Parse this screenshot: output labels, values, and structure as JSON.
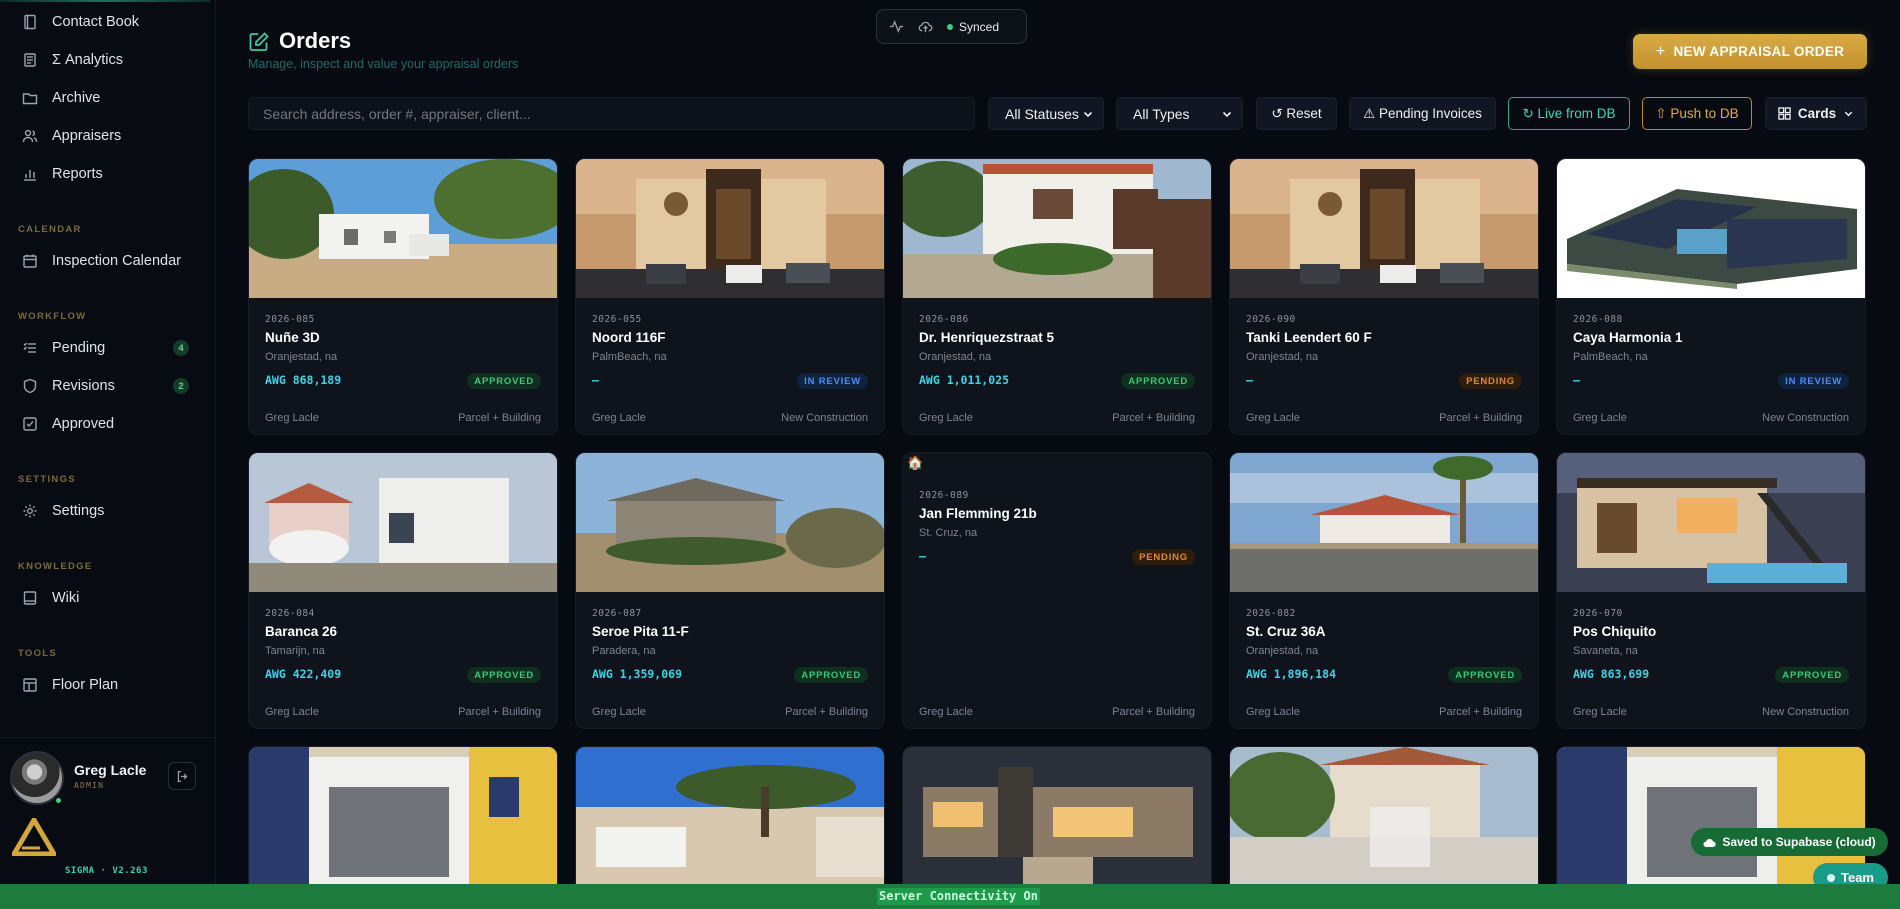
{
  "sidebar": {
    "items": [
      {
        "label": "Contact Book",
        "icon": "book-icon"
      },
      {
        "label": "Σ Analytics",
        "icon": "analytics-icon"
      },
      {
        "label": "Archive",
        "icon": "archive-icon"
      },
      {
        "label": "Appraisers",
        "icon": "users-icon"
      },
      {
        "label": "Reports",
        "icon": "reports-icon"
      }
    ],
    "sections": {
      "calendar": "CALENDAR",
      "workflow": "WORKFLOW",
      "settings": "SETTINGS",
      "knowledge": "KNOWLEDGE",
      "tools": "TOOLS"
    },
    "calendar_items": [
      {
        "label": "Inspection Calendar",
        "icon": "calendar-icon"
      }
    ],
    "workflow_items": [
      {
        "label": "Pending",
        "icon": "list-icon",
        "count": "4"
      },
      {
        "label": "Revisions",
        "icon": "shield-icon",
        "count": "2"
      },
      {
        "label": "Approved",
        "icon": "check-square-icon"
      }
    ],
    "settings_items": [
      {
        "label": "Settings",
        "icon": "gear-icon"
      }
    ],
    "knowledge_items": [
      {
        "label": "Wiki",
        "icon": "wiki-icon"
      }
    ],
    "tools_items": [
      {
        "label": "Floor Plan",
        "icon": "floorplan-icon"
      }
    ],
    "user": {
      "name": "Greg Lacle",
      "role": "ADMIN"
    },
    "version": "SIGMA · V2.263"
  },
  "header": {
    "title": "Orders",
    "subtitle": "Manage, inspect and value your appraisal orders",
    "sync_label": "Synced",
    "new_order_label": "NEW APPRAISAL ORDER"
  },
  "filters": {
    "search_placeholder": "Search address, order #, appraiser, client...",
    "status_select": "All Statuses",
    "type_select": "All Types",
    "reset_label": "↺ Reset",
    "pending_invoices_label": "⚠ Pending Invoices",
    "live_label": "↻ Live from DB",
    "push_label": "⇧ Push to DB",
    "view_label": "Cards"
  },
  "orders": [
    {
      "order": "2026-085",
      "address": "Nuñe 3D",
      "location": "Oranjestad, na",
      "value": "AWG 868,189",
      "status": "APPROVED",
      "appraiser": "Greg Lacle",
      "type": "Parcel + Building"
    },
    {
      "order": "2026-055",
      "address": "Noord 116F",
      "location": "PalmBeach, na",
      "value": "—",
      "status": "IN REVIEW",
      "appraiser": "Greg Lacle",
      "type": "New Construction"
    },
    {
      "order": "2026-086",
      "address": "Dr. Henriquezstraat 5",
      "location": "Oranjestad, na",
      "value": "AWG 1,011,025",
      "status": "APPROVED",
      "appraiser": "Greg Lacle",
      "type": "Parcel + Building"
    },
    {
      "order": "2026-090",
      "address": "Tanki Leendert 60 F",
      "location": "Oranjestad, na",
      "value": "—",
      "status": "PENDING",
      "appraiser": "Greg Lacle",
      "type": "Parcel + Building"
    },
    {
      "order": "2026-088",
      "address": "Caya Harmonia 1",
      "location": "PalmBeach, na",
      "value": "—",
      "status": "IN REVIEW",
      "appraiser": "Greg Lacle",
      "type": "New Construction"
    },
    {
      "order": "2026-084",
      "address": "Baranca 26",
      "location": "Tamarijn, na",
      "value": "AWG 422,409",
      "status": "APPROVED",
      "appraiser": "Greg Lacle",
      "type": "Parcel + Building"
    },
    {
      "order": "2026-087",
      "address": "Seroe Pita 11-F",
      "location": "Paradera, na",
      "value": "AWG 1,359,069",
      "status": "APPROVED",
      "appraiser": "Greg Lacle",
      "type": "Parcel + Building"
    },
    {
      "order": "2026-089",
      "address": "Jan Flemming 21b",
      "location": "St. Cruz, na",
      "value": "—",
      "status": "PENDING",
      "appraiser": "Greg Lacle",
      "type": "Parcel + Building"
    },
    {
      "order": "2026-082",
      "address": "St. Cruz 36A",
      "location": "Oranjestad, na",
      "value": "AWG 1,896,184",
      "status": "APPROVED",
      "appraiser": "Greg Lacle",
      "type": "Parcel + Building"
    },
    {
      "order": "2026-070",
      "address": "Pos Chiquito",
      "location": "Savaneta, na",
      "value": "AWG 863,699",
      "status": "APPROVED",
      "appraiser": "Greg Lacle",
      "type": "New Construction"
    }
  ],
  "toasts": {
    "saved": "Saved to Supabase (cloud)",
    "team": "Team"
  },
  "statusbar": {
    "text": "Server Connectivity On"
  },
  "colors": {
    "accent_teal": "#3fd3bb",
    "accent_gold": "#d9aa45",
    "approved": "#39c879",
    "in_review": "#4f8cf0",
    "pending": "#e08a2e",
    "statusbar": "#1d7b3d"
  }
}
